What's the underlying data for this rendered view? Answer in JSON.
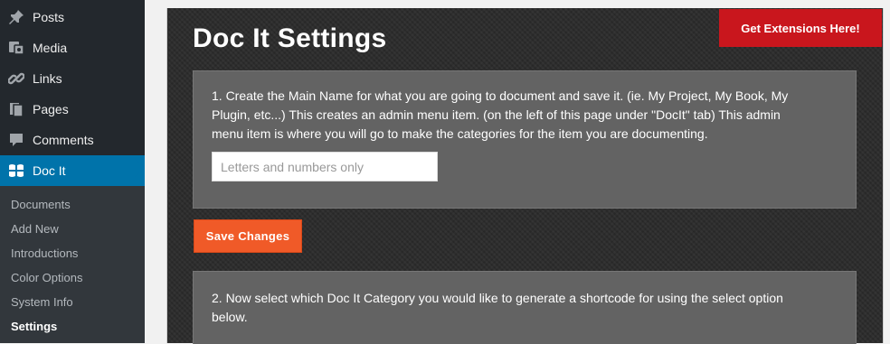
{
  "sidebar": {
    "items": [
      {
        "label": "Posts",
        "icon": "pin-icon"
      },
      {
        "label": "Media",
        "icon": "media-icon"
      },
      {
        "label": "Links",
        "icon": "link-icon"
      },
      {
        "label": "Pages",
        "icon": "pages-icon"
      },
      {
        "label": "Comments",
        "icon": "comment-icon"
      },
      {
        "label": "Doc It",
        "icon": "docit-icon",
        "active": true
      }
    ],
    "submenu": [
      {
        "label": "Documents"
      },
      {
        "label": "Add New"
      },
      {
        "label": "Introductions"
      },
      {
        "label": "Color Options"
      },
      {
        "label": "System Info"
      },
      {
        "label": "Settings",
        "current": true
      }
    ]
  },
  "header": {
    "extensions_label": "Get Extensions Here!",
    "title": "Doc It Settings"
  },
  "step1": {
    "text": "1. Create the Main Name for what you are going to document and save it. (ie. My Project, My Book, My Plugin, etc...) This creates an admin menu item. (on the left of this page under \"DocIt\" tab) This admin menu item is where you will go to make the categories for the item you are documenting.",
    "input_placeholder": "Letters and numbers only",
    "input_value": ""
  },
  "save_label": "Save Changes",
  "step2": {
    "text": "2. Now select which Doc It Category you would like to generate a shortcode for using the select option below."
  },
  "colors": {
    "sidebar_bg": "#23282d",
    "active_blue": "#0073aa",
    "extensions_red": "#c9161d",
    "save_orange": "#f05a28"
  }
}
